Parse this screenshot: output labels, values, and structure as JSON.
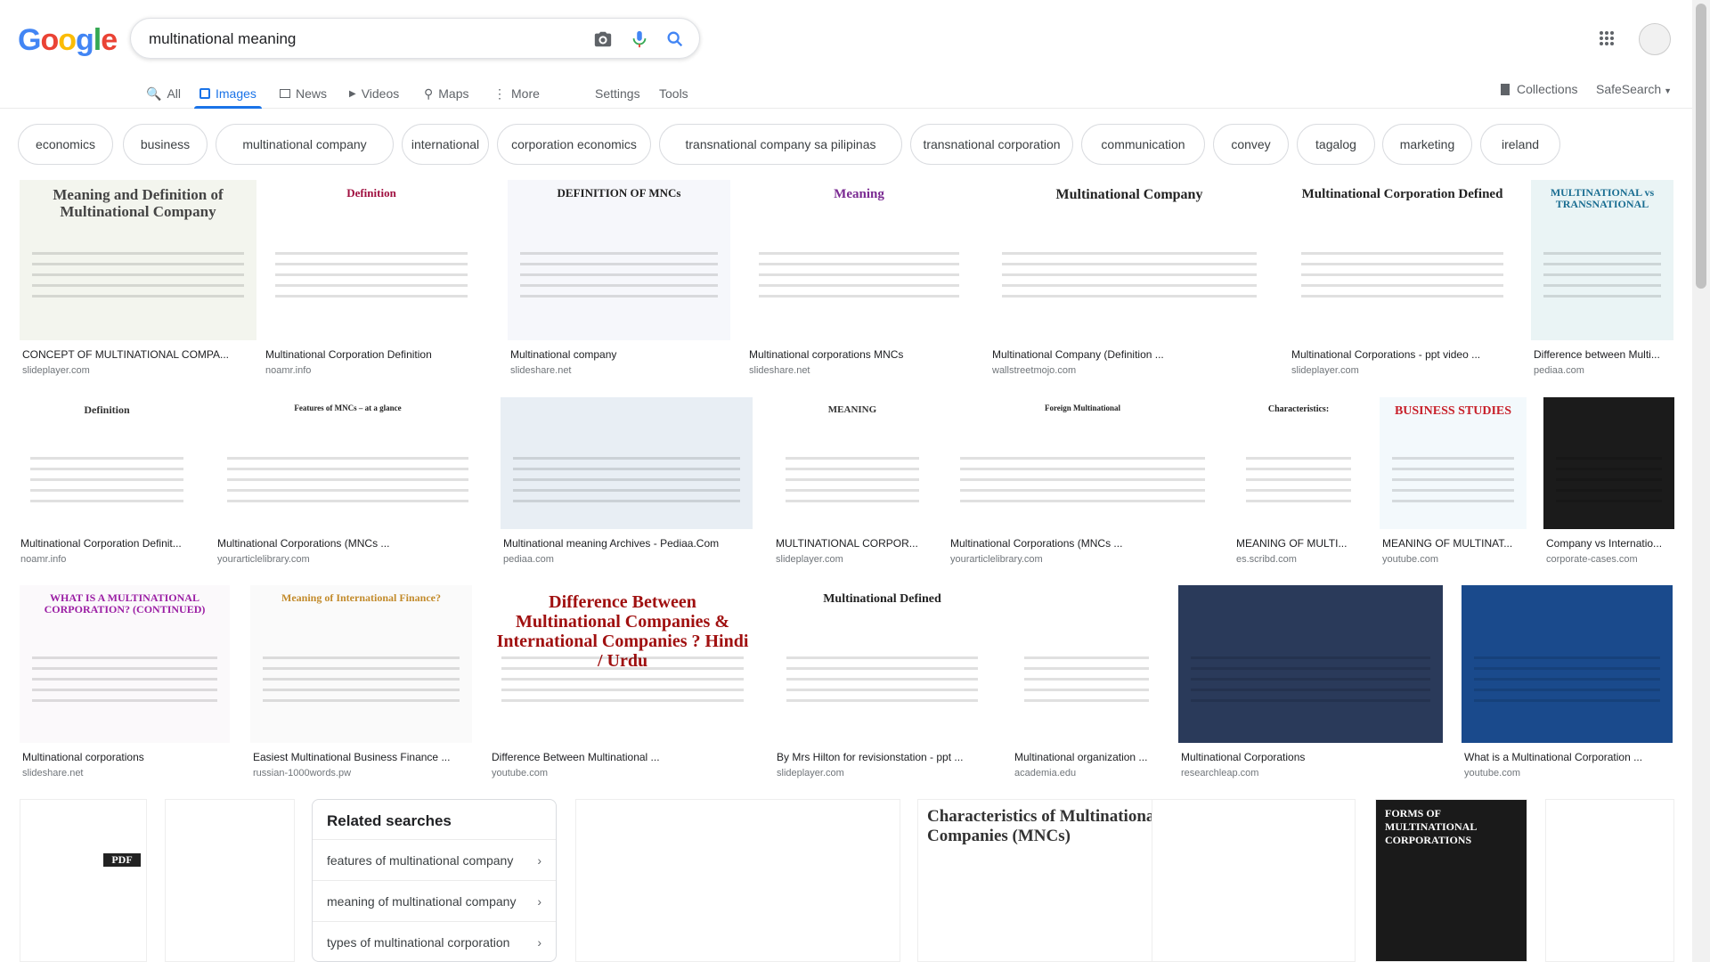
{
  "logo": {
    "letters": [
      "G",
      "o",
      "o",
      "g",
      "l",
      "e"
    ],
    "colors": [
      "#4285f4",
      "#ea4335",
      "#fbbc05",
      "#4285f4",
      "#34a853",
      "#ea4335"
    ]
  },
  "search": {
    "query": "multinational meaning"
  },
  "tabs": [
    {
      "label": "All",
      "icon": "search-icon"
    },
    {
      "label": "Images",
      "icon": "image-icon",
      "active": true
    },
    {
      "label": "News",
      "icon": "news-icon"
    },
    {
      "label": "Videos",
      "icon": "video-icon"
    },
    {
      "label": "Maps",
      "icon": "map-icon"
    },
    {
      "label": "More",
      "icon": "more-vert-icon"
    }
  ],
  "settings_label": "Settings",
  "tools_label": "Tools",
  "collections_label": "Collections",
  "safesearch_label": "SafeSearch",
  "chips": [
    "economics",
    "business",
    "multinational company",
    "international",
    "corporation economics",
    "transnational company sa pilipinas",
    "transnational corporation",
    "communication",
    "convey",
    "tagalog",
    "marketing",
    "ireland"
  ],
  "row1": [
    {
      "caption": "CONCEPT OF MULTINATIONAL COMPA...",
      "source": "slideplayer.com",
      "thumb_title": "Meaning and Definition of Multinational Company"
    },
    {
      "caption": "Multinational Corporation Definition",
      "source": "noamr.info",
      "thumb_title": "Definition"
    },
    {
      "caption": "Multinational company",
      "source": "slideshare.net",
      "thumb_title": "DEFINITION OF MNCs"
    },
    {
      "caption": "Multinational corporations MNCs",
      "source": "slideshare.net",
      "thumb_title": "Meaning"
    },
    {
      "caption": "Multinational Company (Definition ...",
      "source": "wallstreetmojo.com",
      "thumb_title": "Multinational Company"
    },
    {
      "caption": "Multinational Corporations - ppt video ...",
      "source": "slideplayer.com",
      "thumb_title": "Multinational Corporation Defined"
    },
    {
      "caption": "Difference between Multi...",
      "source": "pediaa.com",
      "thumb_title": "MULTINATIONAL vs TRANSNATIONAL"
    }
  ],
  "row2": [
    {
      "caption": "Multinational Corporation Definit...",
      "source": "noamr.info",
      "thumb_title": "Definition"
    },
    {
      "caption": "Multinational Corporations (MNCs ...",
      "source": "yourarticlelibrary.com",
      "thumb_title": "Features of MNCs – at a glance"
    },
    {
      "caption": "Multinational meaning Archives - Pediaa.Com",
      "source": "pediaa.com",
      "thumb_title": ""
    },
    {
      "caption": "MULTINATIONAL CORPOR...",
      "source": "slideplayer.com",
      "thumb_title": "MEANING"
    },
    {
      "caption": "Multinational Corporations (MNCs ...",
      "source": "yourarticlelibrary.com",
      "thumb_title": "Foreign Multinational"
    },
    {
      "caption": "MEANING OF MULTI...",
      "source": "es.scribd.com",
      "thumb_title": "Characteristics:"
    },
    {
      "caption": "MEANING OF MULTINAT...",
      "source": "youtube.com",
      "thumb_title": "BUSINESS STUDIES"
    },
    {
      "caption": "Company vs Internatio...",
      "source": "corporate-cases.com",
      "thumb_title": ""
    }
  ],
  "row3": [
    {
      "caption": "Multinational corporations",
      "source": "slideshare.net",
      "thumb_title": "WHAT IS A MULTINATIONAL CORPORATION? (CONTINUED)"
    },
    {
      "caption": "Easiest Multinational Business Finance ...",
      "source": "russian-1000words.pw",
      "thumb_title": "Meaning of International Finance?"
    },
    {
      "caption": "Difference Between Multinational ...",
      "source": "youtube.com",
      "thumb_title": "Difference Between Multinational Companies & International Companies ? Hindi / Urdu"
    },
    {
      "caption": "By Mrs Hilton for revisionstation - ppt ...",
      "source": "slideplayer.com",
      "thumb_title": "Multinational Defined"
    },
    {
      "caption": "Multinational organization ...",
      "source": "academia.edu",
      "thumb_title": ""
    },
    {
      "caption": "Multinational Corporations",
      "source": "researchleap.com",
      "thumb_title": ""
    },
    {
      "caption": "What is a Multinational Corporation ...",
      "source": "youtube.com",
      "thumb_title": ""
    }
  ],
  "row4_thumbs": [
    "PDF",
    "",
    "",
    "Characteristics of Multinational Companies (MNCs)",
    "",
    "FORMS OF MULTINATIONAL CORPORATIONS",
    ""
  ],
  "related": {
    "title": "Related searches",
    "items": [
      "features of multinational company",
      "meaning of multinational company",
      "types of multinational corporation"
    ]
  }
}
